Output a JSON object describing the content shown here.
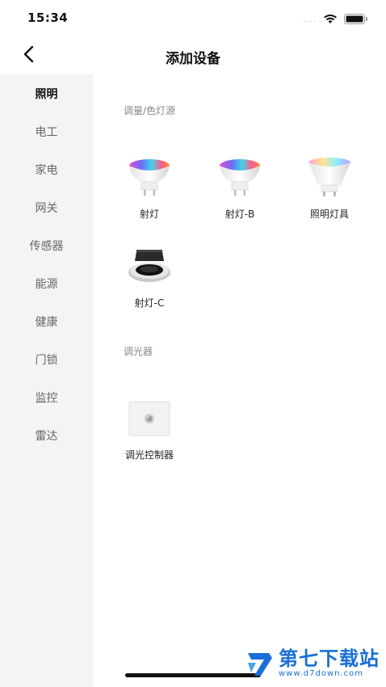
{
  "status": {
    "time": "15:34",
    "signal": "....",
    "wifi_icon": "wifi-icon",
    "battery_icon": "battery-icon"
  },
  "nav": {
    "title": "添加设备",
    "back_icon": "chevron-left-icon"
  },
  "sidebar": {
    "items": [
      {
        "label": "照明",
        "active": true
      },
      {
        "label": "电工",
        "active": false
      },
      {
        "label": "家电",
        "active": false
      },
      {
        "label": "网关",
        "active": false
      },
      {
        "label": "传感器",
        "active": false
      },
      {
        "label": "能源",
        "active": false
      },
      {
        "label": "健康",
        "active": false
      },
      {
        "label": "门锁",
        "active": false
      },
      {
        "label": "监控",
        "active": false
      },
      {
        "label": "雷达",
        "active": false
      }
    ]
  },
  "sections": [
    {
      "title": "调量/色灯源",
      "devices": [
        {
          "label": "射灯",
          "icon": "rgb-spotlight-bulb-icon"
        },
        {
          "label": "射灯-B",
          "icon": "rgb-spotlight-bulb-icon"
        },
        {
          "label": "照明灯具",
          "icon": "rgb-gu10-bulb-icon"
        },
        {
          "label": "射灯-C",
          "icon": "recessed-downlight-icon"
        }
      ]
    },
    {
      "title": "调光器",
      "devices": [
        {
          "label": "调光控制器",
          "icon": "dimmer-panel-icon"
        }
      ]
    }
  ],
  "watermark": {
    "name": "第七下载站",
    "url": "www.d7down.com",
    "accent": "#1a6fd6"
  }
}
